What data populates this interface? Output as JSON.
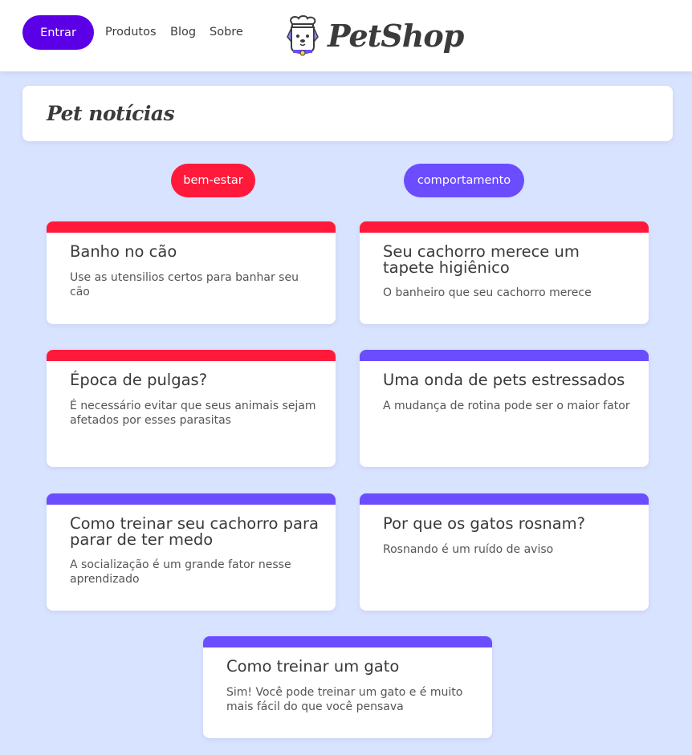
{
  "header": {
    "login_label": "Entrar",
    "nav": [
      "Produtos",
      "Blog",
      "Sobre"
    ],
    "logo_text": "PetShop"
  },
  "page": {
    "title": "Pet notícias"
  },
  "tags": [
    {
      "label": "bem-estar",
      "color": "#ff1a3b"
    },
    {
      "label": "comportamento",
      "color": "#6b4dff"
    }
  ],
  "cards": [
    {
      "title": "Banho no cão",
      "desc": "Use as utensilios certos para banhar seu cão",
      "tag": "bem-estar"
    },
    {
      "title": "Seu cachorro merece um tapete higiênico",
      "desc": "O banheiro que seu cachorro merece",
      "tag": "bem-estar"
    },
    {
      "title": "Época de pulgas?",
      "desc": "É necessário evitar que seus animais sejam afetados por esses parasitas",
      "tag": "bem-estar"
    },
    {
      "title": "Uma onda de pets estressados",
      "desc": "A mudança de rotina pode ser o maior fator",
      "tag": "comportamento"
    },
    {
      "title": "Como treinar seu cachorro para parar de ter medo",
      "desc": "A socialização é um grande fator nesse aprendizado",
      "tag": "comportamento"
    },
    {
      "title": "Por que os gatos rosnam?",
      "desc": "Rosnando é um ruído de aviso",
      "tag": "comportamento"
    },
    {
      "title": "Como treinar um gato",
      "desc": "Sim! Você pode treinar um gato e é muito mais fácil do que você pensava",
      "tag": "comportamento"
    }
  ],
  "colors": {
    "accent": "#5b00e6",
    "red": "#ff1a3b",
    "purple": "#6b4dff",
    "background": "#d8e3ff"
  },
  "icons": {
    "logo": "dog-with-chef-hat-icon"
  }
}
